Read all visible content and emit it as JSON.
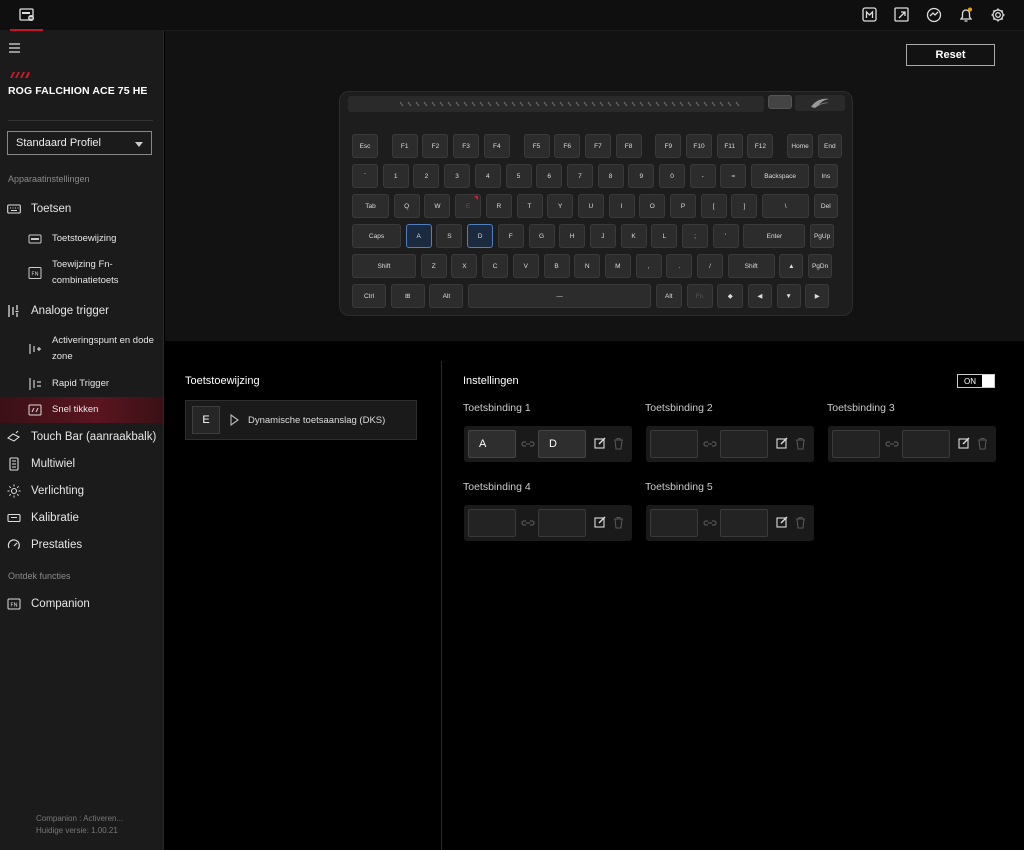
{
  "device": {
    "name": "ROG FALCHION ACE 75 HE"
  },
  "profile": {
    "selected": "Standaard Profiel"
  },
  "sidebar": {
    "section_device": "Apparaatinstellingen",
    "section_discover": "Ontdek functies",
    "items": [
      {
        "label": "Toetsen"
      },
      {
        "label": "Toetstoewijzing"
      },
      {
        "label": "Toewijzing Fn-",
        "label2": "combinatietoets"
      },
      {
        "label": "Analoge trigger"
      },
      {
        "label": "Activeringspunt en dode",
        "label2": "zone"
      },
      {
        "label": "Rapid Trigger"
      },
      {
        "label": "Snel tikken"
      },
      {
        "label": "Touch Bar (aanraakbalk)"
      },
      {
        "label": "Multiwiel"
      },
      {
        "label": "Verlichting"
      },
      {
        "label": "Kalibratie"
      },
      {
        "label": "Prestaties"
      },
      {
        "label": "Companion"
      }
    ],
    "footer_line1": "Companion : Activeren...",
    "footer_line2": "Huidige versie: 1.00.21"
  },
  "toolbar": {
    "reset_label": "Reset"
  },
  "keyboard": {
    "rows": [
      [
        "Esc",
        "F1",
        "F2",
        "F3",
        "F4",
        "F5",
        "F6",
        "F7",
        "F8",
        "F9",
        "F10",
        "F11",
        "F12",
        "Home",
        "End"
      ],
      [
        "`",
        "1",
        "2",
        "3",
        "4",
        "5",
        "6",
        "7",
        "8",
        "9",
        "0",
        "-",
        "=",
        "Backspace",
        "Ins"
      ],
      [
        "Tab",
        "Q",
        "W",
        "E",
        "R",
        "T",
        "Y",
        "U",
        "I",
        "O",
        "P",
        "[",
        "]",
        "\\",
        "Del"
      ],
      [
        "Caps",
        "A",
        "S",
        "D",
        "F",
        "G",
        "H",
        "J",
        "K",
        "L",
        ";",
        "'",
        "Enter",
        "PgUp"
      ],
      [
        "Shift",
        "Z",
        "X",
        "C",
        "V",
        "B",
        "N",
        "M",
        ",",
        ".",
        "/",
        "Shift",
        "▲",
        "PgDn"
      ],
      [
        "Ctrl",
        "⊞",
        "Alt",
        "—",
        "Alt",
        "Fn",
        "◆",
        "◀",
        "▼",
        "▶"
      ]
    ]
  },
  "assignment": {
    "title": "Toetstoewijzing",
    "key": "E",
    "label": "Dynamische toetsaanslag (DKS)"
  },
  "settings": {
    "title": "Instellingen",
    "toggle_label": "ON",
    "bindings": [
      {
        "label": "Toetsbinding 1",
        "key1": "A",
        "key2": "D"
      },
      {
        "label": "Toetsbinding 2",
        "key1": "",
        "key2": ""
      },
      {
        "label": "Toetsbinding 3",
        "key1": "",
        "key2": ""
      },
      {
        "label": "Toetsbinding 4",
        "key1": "",
        "key2": ""
      },
      {
        "label": "Toetsbinding 5",
        "key1": "",
        "key2": ""
      }
    ]
  },
  "colors": {
    "accent": "#c0152a",
    "selected_key": "#4f7fbf"
  }
}
